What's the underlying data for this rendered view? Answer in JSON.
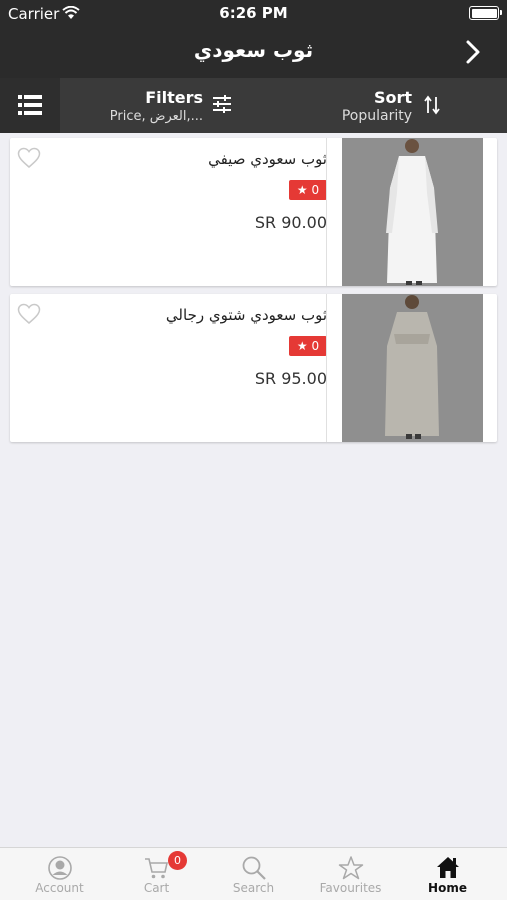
{
  "status": {
    "carrier": "Carrier",
    "time": "6:26 PM"
  },
  "nav": {
    "title": "ثوب سعودي"
  },
  "toolbar": {
    "filters_label": "Filters",
    "filters_sub": "Price, العرض,...",
    "sort_label": "Sort",
    "sort_sub": "Popularity"
  },
  "products": [
    {
      "name": "ثوب سعودي صيفي",
      "rating": "★ 0",
      "price": "SR 90.00",
      "color": "#f4f4f4"
    },
    {
      "name": "ثوب سعودي شتوي رجالي",
      "rating": "★ 0",
      "price": "SR 95.00",
      "color": "#b9b6ae"
    }
  ],
  "tabs": [
    {
      "label": "Account",
      "icon": "account-icon"
    },
    {
      "label": "Cart",
      "icon": "cart-icon",
      "badge": "0"
    },
    {
      "label": "Search",
      "icon": "search-icon"
    },
    {
      "label": "Favourites",
      "icon": "star-icon"
    },
    {
      "label": "Home",
      "icon": "home-icon",
      "active": true
    }
  ],
  "colors": {
    "bar_dark": "#2b2b2b",
    "accent_red": "#e53935",
    "tab_inactive": "#a9a9a9"
  }
}
